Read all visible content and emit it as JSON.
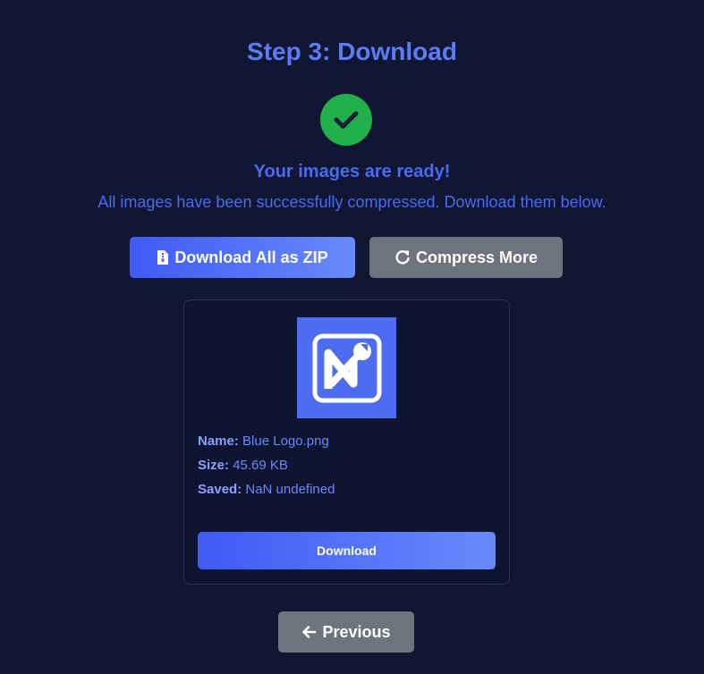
{
  "header": {
    "title": "Step 3: Download"
  },
  "status": {
    "icon": "check-icon",
    "heading": "Your images are ready!",
    "description": "All images have been successfully compressed. Download them below."
  },
  "actions": {
    "download_all_label": "Download All as ZIP",
    "download_all_icon": "file-zip-icon",
    "compress_more_label": "Compress More",
    "compress_more_icon": "redo-icon"
  },
  "file": {
    "name_label": "Name:",
    "name_value": "Blue Logo.png",
    "size_label": "Size:",
    "size_value": "45.69 KB",
    "saved_label": "Saved:",
    "saved_value": "NaN undefined",
    "download_label": "Download"
  },
  "nav": {
    "previous_label": "Previous",
    "previous_icon": "arrow-left-icon"
  },
  "colors": {
    "background": "#111733",
    "accent": "#5b7cf6",
    "success": "#22b04b",
    "secondary_button": "#6c757d"
  }
}
